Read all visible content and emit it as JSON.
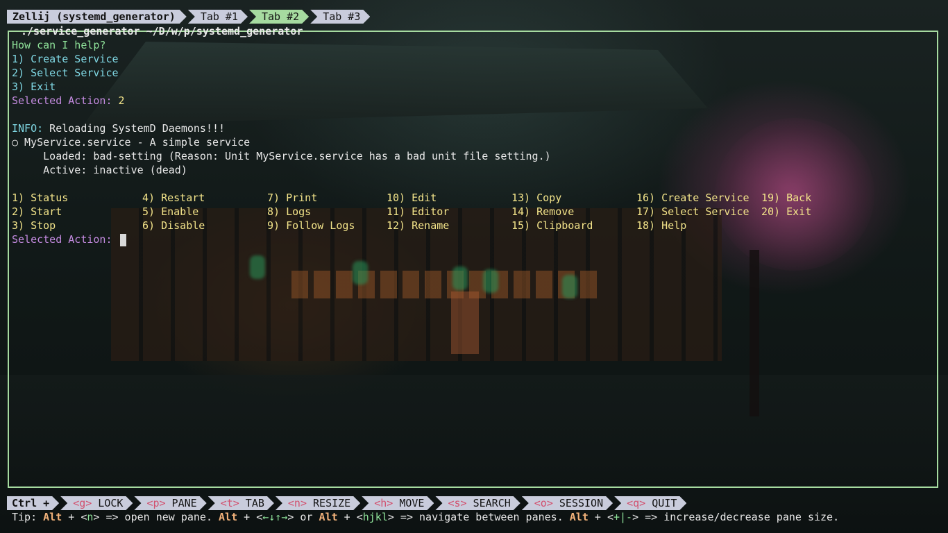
{
  "tabbar": {
    "session": "Zellij (systemd_generator)",
    "tabs": [
      {
        "label": "Tab #1",
        "active": false
      },
      {
        "label": "Tab #2",
        "active": true
      },
      {
        "label": "Tab #3",
        "active": false
      }
    ]
  },
  "pane": {
    "title": " ./service_generator ~/D/w/p/systemd_generator "
  },
  "terminal": {
    "prompt": "How can I help?",
    "options": [
      "1) Create Service",
      "2) Select Service",
      "3) Exit"
    ],
    "selected_label": "Selected Action:",
    "selected_value": "2",
    "info_label": "INFO:",
    "info_text": " Reloading SystemD Daemons!!!",
    "status_line": "○ MyService.service - A simple service",
    "loaded_line": "     Loaded: bad-setting (Reason: Unit MyService.service has a bad unit file setting.)",
    "active_line": "     Active: inactive (dead)",
    "menu": [
      [
        "1) Status",
        "4) Restart",
        "7) Print",
        "10) Edit",
        "13) Copy",
        "16) Create Service",
        "19) Back"
      ],
      [
        "2) Start",
        "5) Enable",
        "8) Logs",
        "11) Editor",
        "14) Remove",
        "17) Select Service",
        "20) Exit"
      ],
      [
        "3) Stop",
        "6) Disable",
        "9) Follow Logs",
        "12) Rename",
        "15) Clipboard",
        "18) Help",
        ""
      ]
    ],
    "selected_label_2": "Selected Action:"
  },
  "keybar": {
    "ctrl": "Ctrl +",
    "keys": [
      {
        "key": "<g>",
        "label": " LOCK"
      },
      {
        "key": "<p>",
        "label": " PANE"
      },
      {
        "key": "<t>",
        "label": " TAB"
      },
      {
        "key": "<n>",
        "label": " RESIZE"
      },
      {
        "key": "<h>",
        "label": " MOVE"
      },
      {
        "key": "<s>",
        "label": " SEARCH"
      },
      {
        "key": "<o>",
        "label": " SESSION"
      },
      {
        "key": "<q>",
        "label": " QUIT"
      }
    ]
  },
  "tip": {
    "prefix": "Tip: ",
    "alt1": "Alt",
    "t1": " + <",
    "k1": "n",
    "t2": "> => open new pane. ",
    "alt2": "Alt",
    "t3": " + <",
    "k2": "←↓↑→",
    "t4": "> or ",
    "alt3": "Alt",
    "t5": " + <",
    "k3": "hjkl",
    "t6": "> => navigate between panes. ",
    "alt4": "Alt",
    "t7": " + <",
    "k4": "+|-",
    "t8": "> => increase/decrease pane size."
  }
}
